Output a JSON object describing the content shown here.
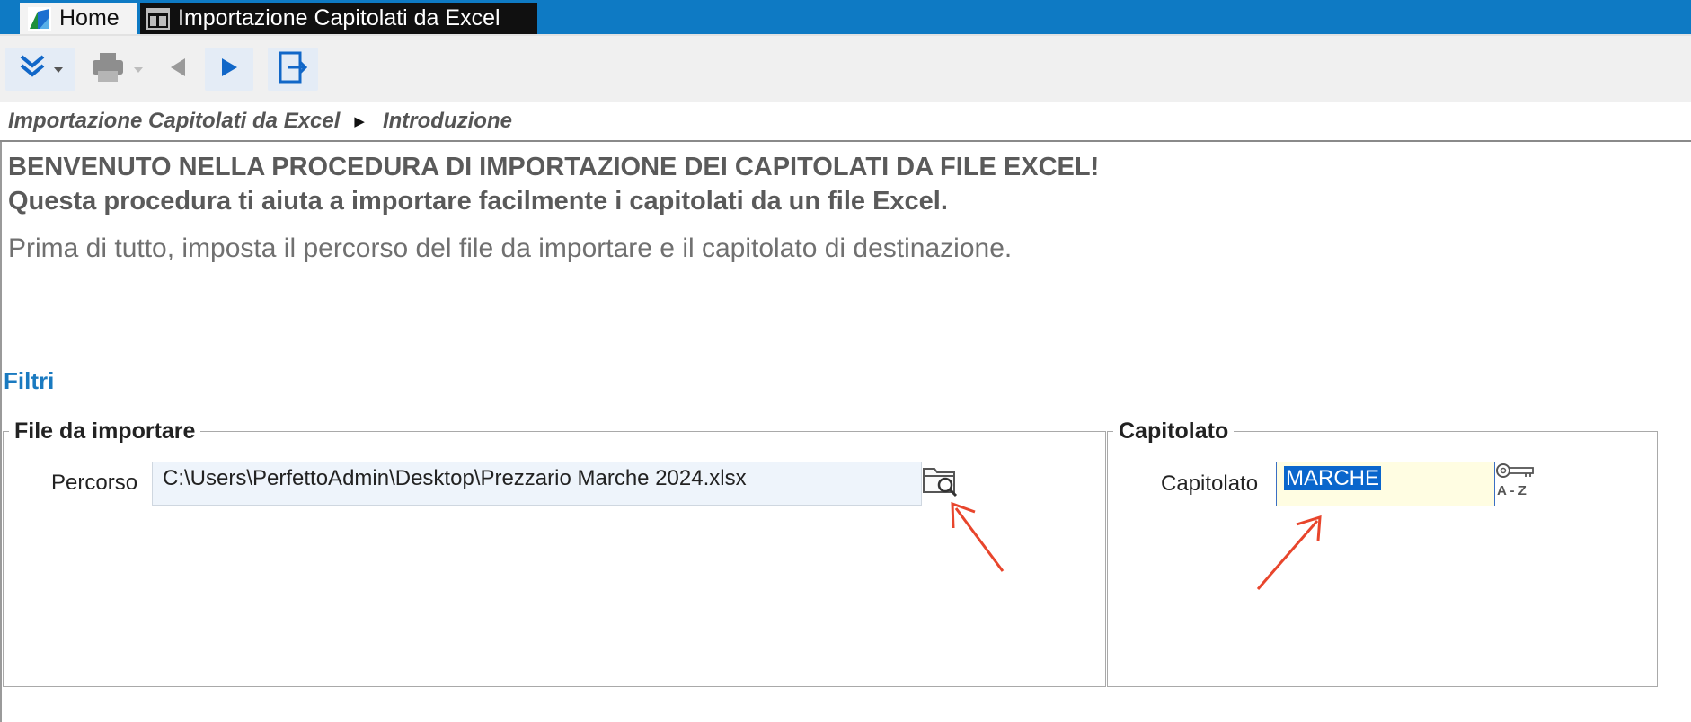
{
  "tabs": [
    {
      "label": "Home",
      "icon": "app-logo-icon"
    },
    {
      "label": "Importazione Capitolati da Excel",
      "icon": "window-layout-icon"
    }
  ],
  "toolbar": {
    "buttons": [
      "expand-menu-icon",
      "print-icon",
      "back-arrow-icon",
      "forward-arrow-icon",
      "exit-icon"
    ]
  },
  "breadcrumb": {
    "items": [
      "Importazione Capitolati da Excel",
      "Introduzione"
    ]
  },
  "content": {
    "headline1": "BENVENUTO NELLA PROCEDURA DI IMPORTAZIONE DEI CAPITOLATI DA FILE EXCEL!",
    "headline2": "Questa procedura ti aiuta a importare facilmente i capitolati da un file Excel.",
    "intro": "Prima di tutto, imposta il percorso del file da importare e il capitolato di destinazione."
  },
  "filters": {
    "title": "Filtri",
    "file_group": {
      "legend": "File da importare",
      "path_label": "Percorso",
      "path_value": "C:\\Users\\PerfettoAdmin\\Desktop\\Prezzario Marche 2024.xlsx"
    },
    "capitolato_group": {
      "legend": "Capitolato",
      "label": "Capitolato",
      "value": "MARCHE",
      "lookup_text": "A - Z"
    }
  },
  "colors": {
    "tab_bar": "#0e7ac4",
    "accent": "#1a7ac0",
    "annotation_arrow": "#e8452c",
    "selection": "#0a66cc"
  }
}
